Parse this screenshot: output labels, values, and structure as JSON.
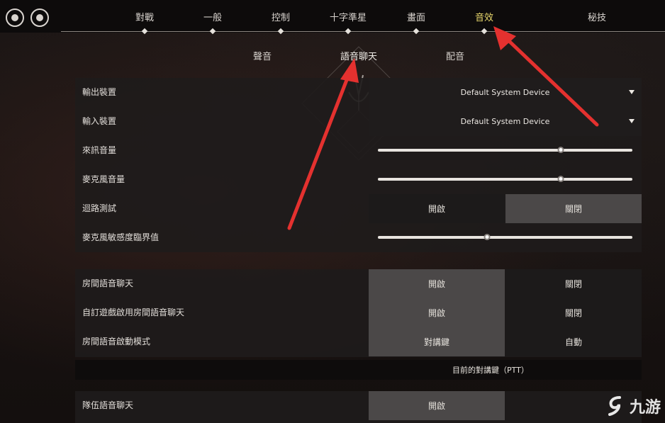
{
  "top_nav": {
    "tabs": [
      {
        "label": "對戰"
      },
      {
        "label": "一般"
      },
      {
        "label": "控制"
      },
      {
        "label": "十字準星"
      },
      {
        "label": "畫面"
      },
      {
        "label": "音效",
        "active": true
      },
      {
        "label": "秘技"
      }
    ],
    "active_color": "#e8d76c"
  },
  "sub_nav": {
    "tabs": [
      {
        "label": "聲音"
      },
      {
        "label": "語音聊天",
        "active": true
      },
      {
        "label": "配音"
      }
    ]
  },
  "device_panel": {
    "output_device": {
      "label": "輸出裝置",
      "value": "Default System Device"
    },
    "input_device": {
      "label": "輸入裝置",
      "value": "Default System Device"
    },
    "incoming_volume": {
      "label": "來訊音量",
      "level": 0.72
    },
    "mic_volume": {
      "label": "麥克風音量",
      "level": 0.72
    },
    "loopback_test": {
      "label": "迴路測試",
      "on_label": "開啟",
      "off_label": "關閉",
      "selected": "off"
    },
    "mic_threshold": {
      "label": "麥克風敏感度臨界值",
      "level": 0.43
    }
  },
  "party_panel": {
    "party_voice": {
      "label": "房間語音聊天",
      "on_label": "開啟",
      "off_label": "關閉",
      "selected": "on"
    },
    "custom_party_voice": {
      "label": "自訂遊戲啟用房間語音聊天",
      "on_label": "開啟",
      "off_label": "關閉",
      "selected": "on"
    },
    "activation_mode": {
      "label": "房間語音啟動模式",
      "ptt_label": "對講鍵",
      "auto_label": "自動",
      "selected": "ptt"
    },
    "current_ptt": {
      "label": "目前的對講鍵（PTT）"
    }
  },
  "team_panel": {
    "team_voice": {
      "label": "隊伍語音聊天",
      "on_label": "開啟",
      "selected": "on"
    }
  },
  "watermark": {
    "text": "九游"
  },
  "annotation_color": "#e4312f"
}
